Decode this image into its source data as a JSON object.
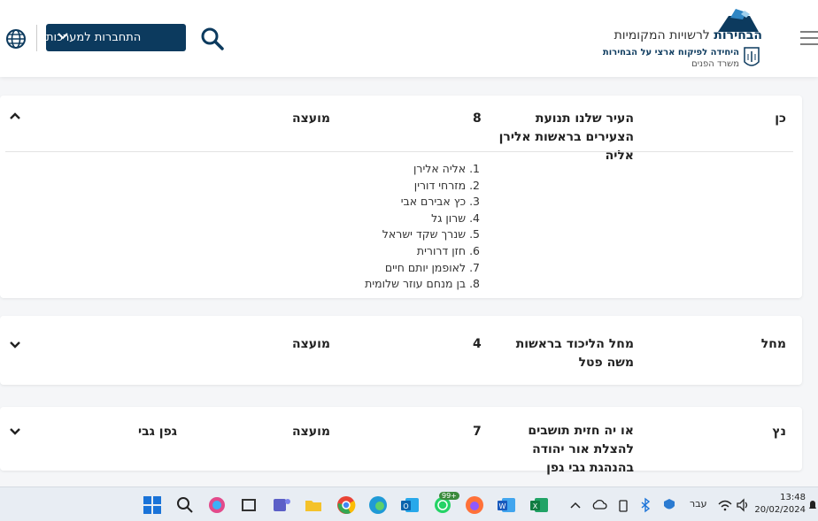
{
  "header": {
    "logo_title_bold": "הבחירות",
    "logo_title_rest": "לרשויות המקומיות",
    "logo_subtitle": "היחידה לפיקוח ארצי על הבחירות",
    "logo_ministry": "משרד הפנים",
    "systems_button_label": "התחברות למערכות"
  },
  "cards": [
    {
      "city": "כן",
      "list_name": "העיר שלנו תנועת הצעירים בראשות אלירן אליה",
      "list_number": "8",
      "type": "מועצה",
      "head": "",
      "expanded": true,
      "members": [
        "1. אליה אלירן",
        "2. מזרחי דורין",
        "3. כץ אבירם אבי",
        "4. שרון גל",
        "5. שנרך שקד ישראל",
        "6. חזן דרורית",
        "7. לאופמן יותם חיים",
        "8. בן מנחם עוזר שלומית"
      ]
    },
    {
      "city": "מחל",
      "list_name": "מחל הליכוד בראשות משה פטל",
      "list_number": "4",
      "type": "מועצה",
      "head": "",
      "expanded": false
    },
    {
      "city": "נץ",
      "list_name": "או יה חזית תושבים להצלת אור יהודה בהנהגת גבי גפן",
      "list_number": "7",
      "type": "מועצה",
      "head": "גפן גבי",
      "expanded": false
    }
  ],
  "taskbar": {
    "whatsapp_badge": "99+",
    "language": "עבר",
    "time": "13:48",
    "date": "20/02/2024"
  },
  "colors": {
    "brand": "#0c3a5e",
    "page_bg": "#f5f6f8"
  }
}
